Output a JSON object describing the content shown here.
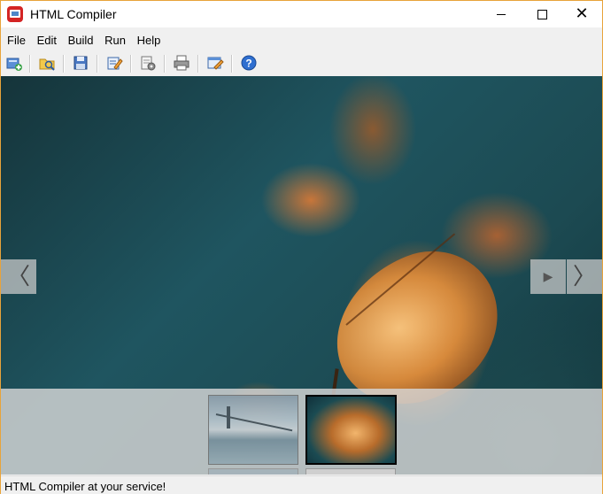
{
  "window": {
    "title": "HTML Compiler"
  },
  "menu": {
    "items": [
      {
        "label": "File"
      },
      {
        "label": "Edit"
      },
      {
        "label": "Build"
      },
      {
        "label": "Run"
      },
      {
        "label": "Help"
      }
    ]
  },
  "toolbar": {
    "buttons": [
      {
        "icon": "new-project-icon"
      },
      {
        "icon": "open-folder-icon"
      },
      {
        "icon": "save-icon"
      },
      {
        "icon": "edit-icon"
      },
      {
        "icon": "settings-icon"
      },
      {
        "icon": "print-icon"
      },
      {
        "icon": "compile-icon"
      },
      {
        "icon": "help-icon"
      }
    ]
  },
  "viewer": {
    "prev_glyph": "〈",
    "play_glyph": "▶",
    "next_glyph": "〉"
  },
  "status": {
    "text": "HTML Compiler at your service!"
  },
  "colors": {
    "accent_border": "#e8a33a",
    "app_icon": "#d42424"
  }
}
